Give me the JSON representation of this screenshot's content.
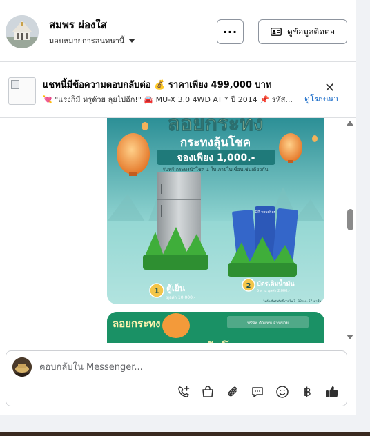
{
  "header": {
    "page_name": "สมพร ผ่องใส",
    "subtitle": "มอบหมายการสนทนานี้",
    "more_label": "···",
    "contact_label": "ดูข้อมูลติดต่อ"
  },
  "ad": {
    "title": "แชทนี้มีข้อความตอบกลับต่อ 💰 ราคาเพียง 499,000 บาท",
    "subtitle": "💘 \"แรงก็มี หรูด้วย ลุยไปอีก!\" 🚘 MU-X 3.0 4WD AT * ปี 2014 📌 รหัส...",
    "link_label": "ดูโฆษณา",
    "close_label": "✕"
  },
  "promo_card": {
    "headline": "ลอยกระทง",
    "banner_line1": "กระทงลุ้นโชค",
    "banner_line2": "จองเพียง 1,000.-",
    "banner_line3": "รับฟรี กระทงนำโชค 1 ใบ ภายในเขื่อนเช่นเดียวกัน",
    "prize1_num": "1",
    "prize1_title": "ตู้เย็น",
    "prize1_value": "มูลค่า 10,000.-",
    "prize2_num": "2",
    "prize2_title": "บัตรเติมน้ำมัน",
    "prize2_value": "5 ท่าน มูลค่า 2,000.-",
    "voucher_label": "GR voucher",
    "fine_print": "ไม่ต้องยืนยันสิทธิ์ ภายใน 7 - 10 พ.ย. 67 เท่านั้น"
  },
  "promo_card2": {
    "headline": "ลอยกระทง",
    "brand": "บริษัท ตัวแทน จำหน่าย"
  },
  "composer": {
    "placeholder": "ตอบกลับใน Messenger..."
  },
  "icons": [
    "phone-plus-icon",
    "shopping-bag-icon",
    "paperclip-icon",
    "chat-bubble-icon",
    "smiley-icon",
    "baht-icon",
    "thumbs-up-icon"
  ],
  "colors": {
    "link": "#1a6cc9",
    "promo_teal": "#2a8f8f",
    "promo_green": "#1b9c63",
    "lantern_orange": "#f39a3a"
  }
}
